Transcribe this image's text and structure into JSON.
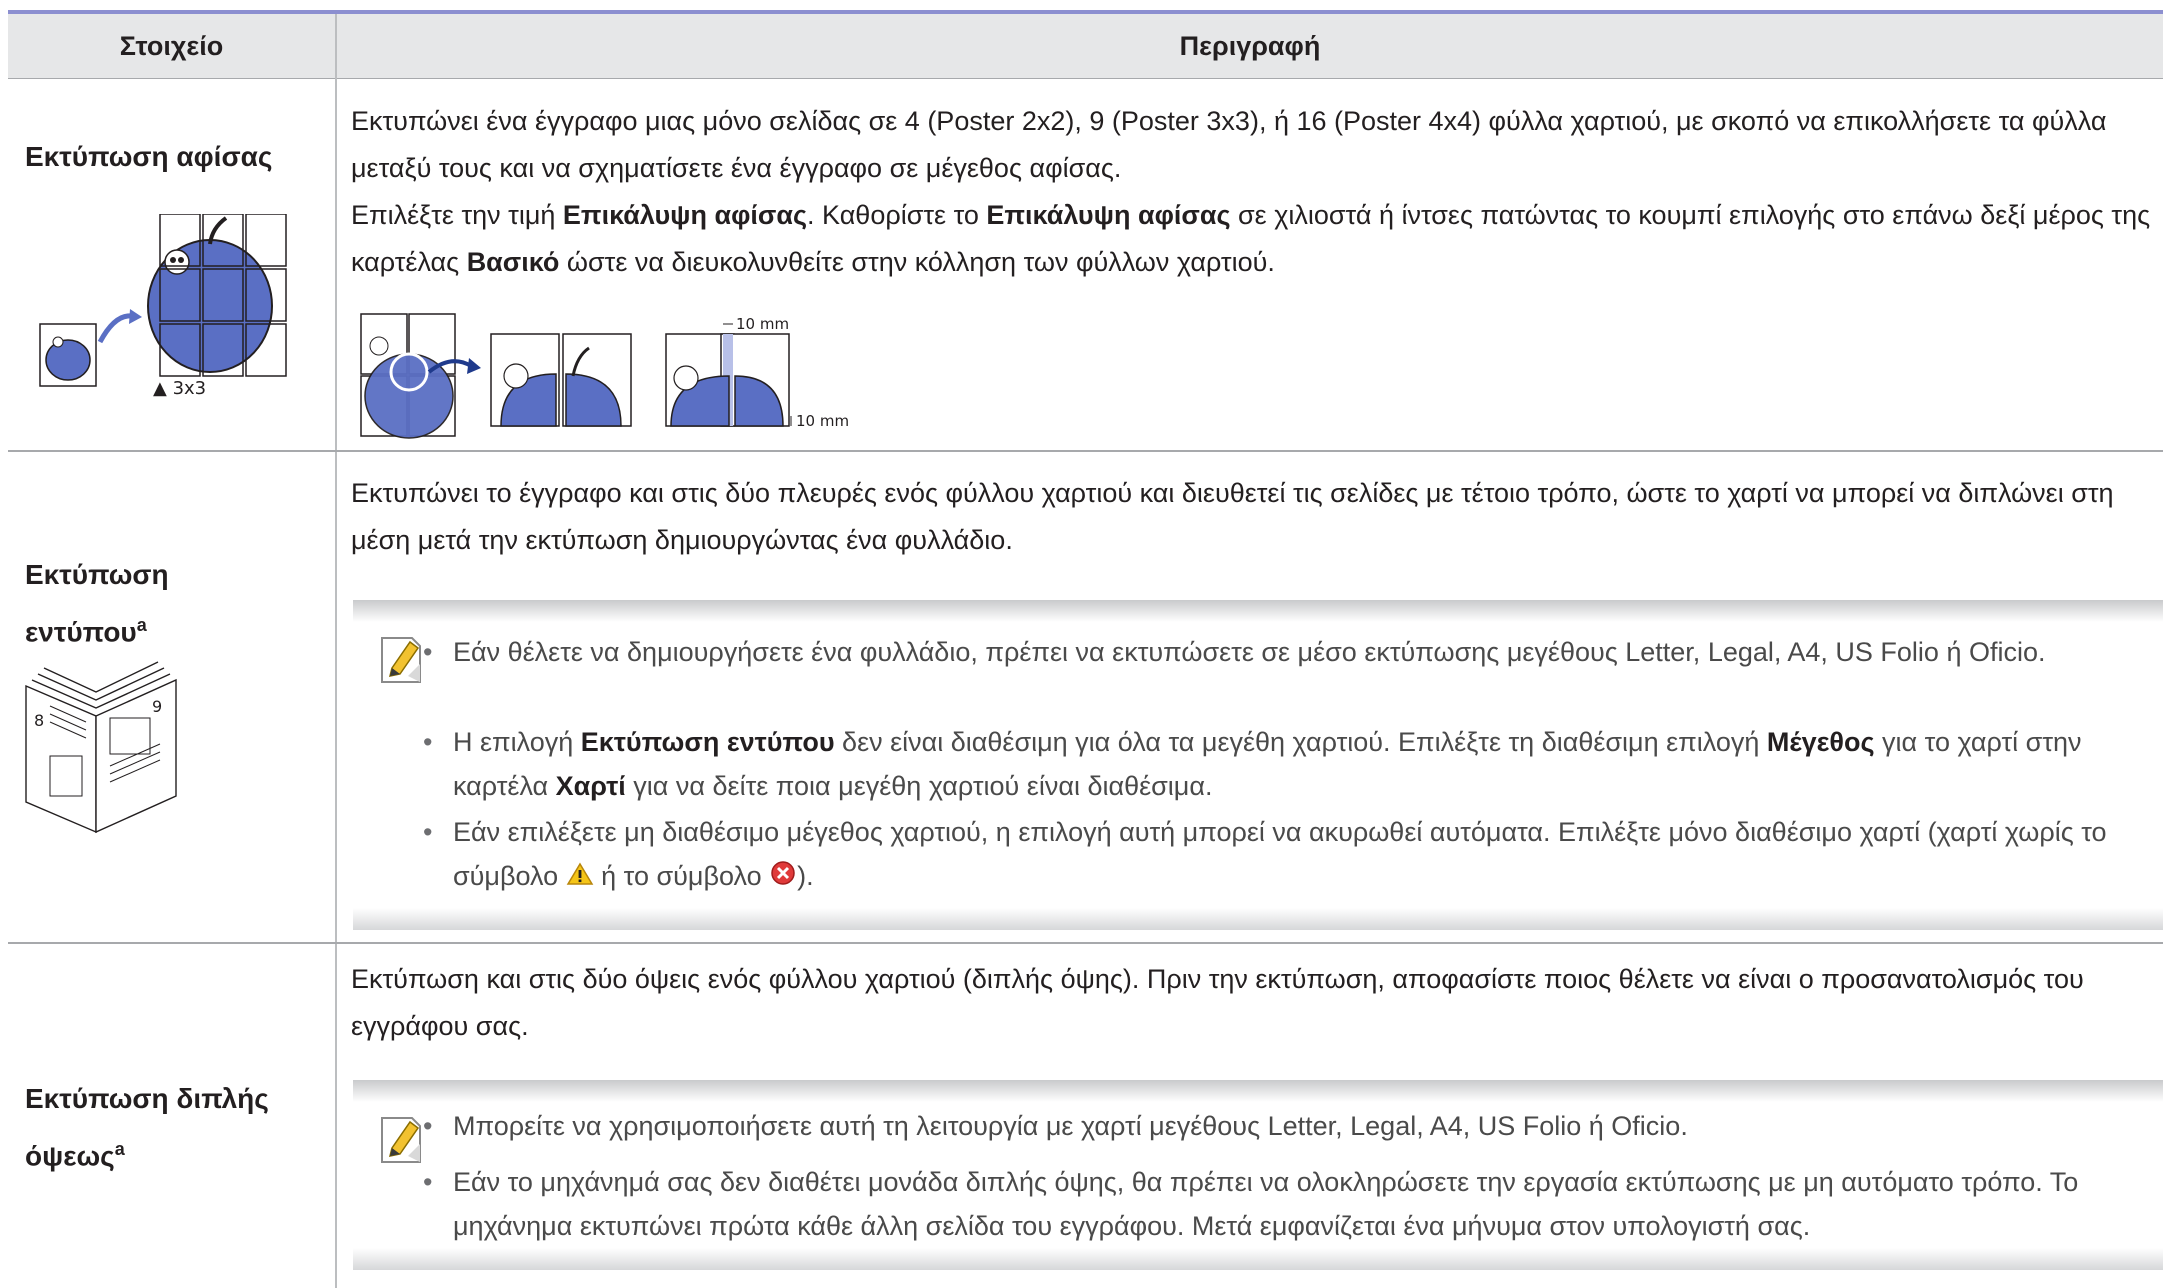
{
  "table": {
    "headers": {
      "item": "Στοιχείο",
      "description": "Περιγραφή"
    },
    "rows": [
      {
        "title": "Εκτύπωση αφίσας",
        "desc_1": "Εκτυπώνει ένα έγγραφο μιας μόνο σελίδας σε 4 (Poster 2x2), 9 (Poster 3x3), ή 16 (Poster 4x4) φύλλα χαρτιού, με σκοπό να επικολλήσετε τα φύλλα μεταξύ τους και να σχηματίσετε ένα έγγραφο σε μέγεθος αφίσας.",
        "desc_2": {
          "t1": "Επιλέξτε την τιμή ",
          "b1": "Επικάλυψη αφίσας",
          "t2": ". Καθορίστε το ",
          "b2": "Επικάλυψη αφίσας",
          "t3": " σε χιλιοστά ή ίντσες πατώντας το κουμπί επιλογής στο επάνω δεξί μέρος της καρτέλας ",
          "b3": "Βασικό",
          "t4": " ώστε να διευκολυνθείτε στην κόλληση των φύλλων χαρτιού."
        },
        "grid_label": "▲ 3x3",
        "overlap_top": "10 mm",
        "overlap_bottom": "10 mm"
      },
      {
        "title": "Εκτύπωση",
        "title_2": "εντύπου",
        "title_sup": "a",
        "desc_1": "Εκτυπώνει το έγγραφο και στις δύο πλευρές ενός φύλλου χαρτιού και διευθετεί τις σελίδες με τέτοιο τρόπο, ώστε το χαρτί να μπορεί να διπλώνει στη μέση μετά την εκτύπωση δημιουργώντας ένα φυλλάδιο.",
        "booklet_left_page": "8",
        "booklet_right_page": "9",
        "notes": {
          "n1": "Εάν θέλετε να δημιουργήσετε ένα φυλλάδιο, πρέπει να εκτυπώσετε σε μέσο εκτύπωσης μεγέθους Letter, Legal, A4, US Folio ή Oficio.",
          "n2": {
            "t1": "Η επιλογή ",
            "b1": "Εκτύπωση εντύπου",
            "t2": " δεν είναι διαθέσιμη για όλα τα μεγέθη χαρτιού. Επιλέξτε τη διαθέσιμη επιλογή ",
            "b2": "Μέγεθος",
            "t3": " για το χαρτί στην καρτέλα ",
            "b3": "Χαρτί",
            "t4": " για να δείτε ποια μεγέθη χαρτιού είναι διαθέσιμα."
          },
          "n3": {
            "t1": "Εάν επιλέξετε μη διαθέσιμο μέγεθος χαρτιού, η επιλογή αυτή μπορεί να ακυρωθεί αυτόματα. Επιλέξτε μόνο διαθέσιμο χαρτί (χαρτί χωρίς το σύμβολο ",
            "t2": " ή το σύμβολο ",
            "t3": ")."
          }
        }
      },
      {
        "title": "Εκτύπωση διπλής",
        "title_2": "όψεως",
        "title_sup": "a",
        "desc_1": "Εκτύπωση και στις δύο όψεις ενός φύλλου χαρτιού (διπλής όψης). Πριν την εκτύπωση, αποφασίστε ποιος θέλετε να είναι ο προσανατολισμός του εγγράφου σας.",
        "notes": {
          "n1": "Μπορείτε να χρησιμοποιήσετε αυτή τη λειτουργία με χαρτί μεγέθους Letter, Legal, A4, US Folio ή Oficio.",
          "n2": "Εάν το μηχάνημά σας δεν διαθέτει μονάδα διπλής όψης, θα πρέπει να ολοκληρώσετε την εργασία εκτύπωσης με μη αυτόματο τρόπο. Το μηχάνημα εκτυπώνει πρώτα κάθε άλλη σελίδα του εγγράφου. Μετά εμφανίζεται ένα μήνυμα στον υπολογιστή σας."
        }
      }
    ]
  },
  "bullet_char": "•",
  "icons": {
    "note": "note-pencil-icon",
    "warning": "warning-triangle-icon",
    "error": "error-x-icon"
  },
  "colors": {
    "header_bg": "#e6e7e8",
    "top_rule": "#8c8fd0",
    "apple_blue": "#5a6fc4"
  }
}
